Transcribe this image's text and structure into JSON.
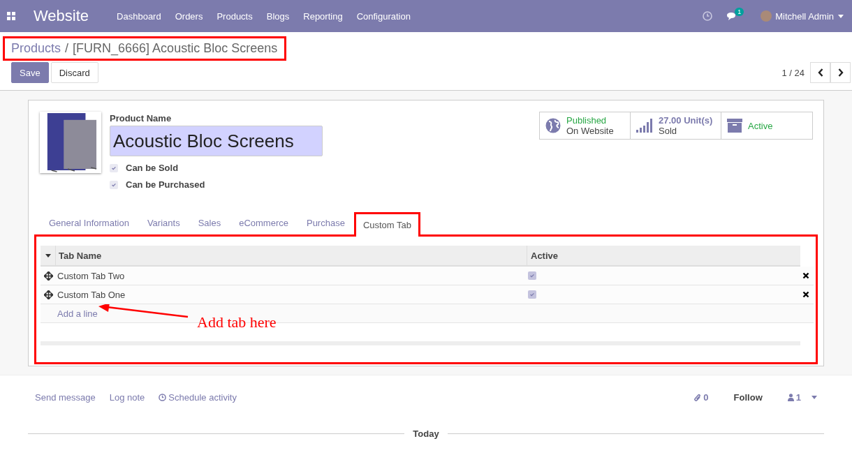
{
  "navbar": {
    "app_title": "Website",
    "menu": [
      "Dashboard",
      "Orders",
      "Products",
      "Blogs",
      "Reporting",
      "Configuration"
    ],
    "messages_badge": "1",
    "user": "Mitchell Admin"
  },
  "breadcrumb": {
    "parent": "Products",
    "separator": "/",
    "current": "[FURN_6666] Acoustic Bloc Screens"
  },
  "buttons": [
    {
      "label": "Save",
      "kind": "primary"
    },
    {
      "label": "Discard",
      "kind": "secondary"
    }
  ],
  "pager": "1 / 24",
  "product": {
    "name_label": "Product Name",
    "name": "Acoustic Bloc Screens",
    "checkboxes": [
      {
        "label": "Can be Sold",
        "checked": true
      },
      {
        "label": "Can be Purchased",
        "checked": true
      }
    ]
  },
  "stat_buttons": [
    {
      "kind": "globe",
      "value": "Published",
      "label": "On Website"
    },
    {
      "kind": "sales",
      "value": "27.00",
      "unit": "Unit(s)",
      "label": "Sold"
    },
    {
      "kind": "archive",
      "value": "Active"
    }
  ],
  "tabs": [
    {
      "label": "General Information",
      "selected": false
    },
    {
      "label": "Variants",
      "selected": false
    },
    {
      "label": "Sales",
      "selected": false
    },
    {
      "label": "eCommerce",
      "selected": false
    },
    {
      "label": "Purchase",
      "selected": false
    },
    {
      "label": "Custom Tab",
      "selected": true
    }
  ],
  "table": {
    "columns": [
      "Tab Name",
      "Active"
    ],
    "rows": [
      {
        "name": "Custom Tab Two",
        "active": true
      },
      {
        "name": "Custom Tab One",
        "active": true
      }
    ],
    "add_line": "Add a line"
  },
  "annotation": "Add tab here",
  "chatter": {
    "actions": [
      {
        "label": "Send message",
        "kind": "plain"
      },
      {
        "label": "Log note",
        "kind": "plain"
      },
      {
        "label": "Schedule activity",
        "kind": "activity"
      }
    ],
    "attachments": "0",
    "follow": "Follow",
    "followers": "1",
    "date_separator": "Today"
  }
}
